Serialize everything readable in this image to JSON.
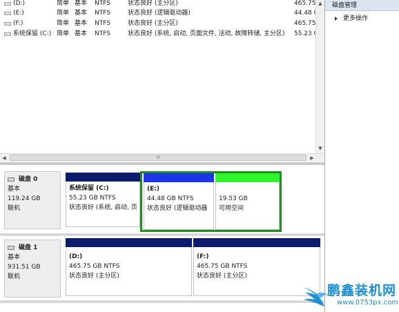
{
  "volumes": [
    {
      "name": "(D:)",
      "layout": "简单",
      "type": "基本",
      "fs": "NTFS",
      "status": "状态良好 (主分区)",
      "capacity": "465.75 G"
    },
    {
      "name": "(E:)",
      "layout": "简单",
      "type": "基本",
      "fs": "NTFS",
      "status": "状态良好 (逻辑驱动器)",
      "capacity": "44.48 GB"
    },
    {
      "name": "(F:)",
      "layout": "简单",
      "type": "基本",
      "fs": "NTFS",
      "status": "状态良好 (主分区)",
      "capacity": "465.75 G"
    },
    {
      "name": "系统保留 (C:)",
      "layout": "简单",
      "type": "基本",
      "fs": "NTFS",
      "status": "状态良好 (系统, 启动, 页面文件, 活动, 故障转储, 主分区)",
      "capacity": "55.23 GB"
    }
  ],
  "scrollbar": {
    "thumb_glyph": "III"
  },
  "disks": [
    {
      "name": "磁盘 0",
      "type": "基本",
      "size": "119.24 GB",
      "state": "联机"
    },
    {
      "name": "磁盘 1",
      "type": "基本",
      "size": "931.51 GB",
      "state": "联机"
    }
  ],
  "partitions": {
    "c": {
      "title": "系统保留 (C:)",
      "size": "55.23 GB NTFS",
      "status": "状态良好 (系统, 启动, 页"
    },
    "e": {
      "title": "(E:)",
      "size": "44.48 GB NTFS",
      "status": "状态良好 (逻辑驱动器"
    },
    "free": {
      "size": "19.53 GB",
      "status": "可用空间"
    },
    "d": {
      "title": "(D:)",
      "size": "465.75 GB NTFS",
      "status": "状态良好 (主分区)"
    },
    "f": {
      "title": "(F:)",
      "size": "465.75 GB NTFS",
      "status": "状态良好 (主分区)"
    }
  },
  "actions": {
    "header": "磁盘管理",
    "more": "更多操作"
  },
  "watermark": {
    "title": "鹏鑫装机网",
    "url": "www.0753px.com"
  },
  "colors": {
    "primary": "#0c1b6e",
    "logical": "#1d35e8",
    "free": "#2ef52e",
    "extended_frame": "#228b22",
    "watermark": "#1f8fd6"
  }
}
